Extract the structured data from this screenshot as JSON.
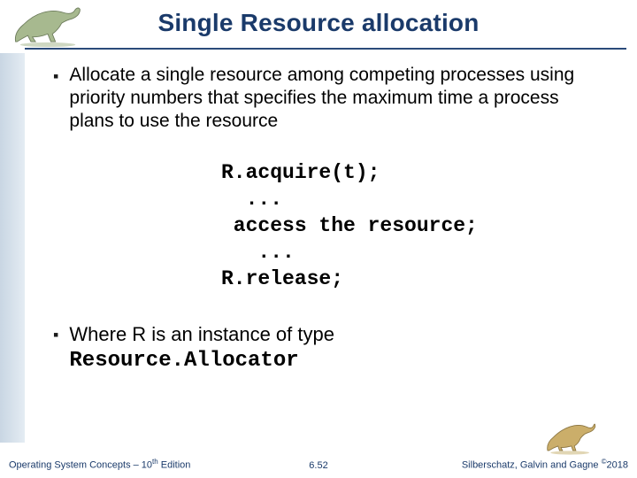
{
  "title": "Single Resource allocation",
  "bullets": {
    "b1": "Allocate a single resource among competing processes using priority numbers that specifies  the maximum time a process  plans to use the resource",
    "b2_prefix": "Where R is an instance of  type ",
    "b2_code": "Resource.Allocator"
  },
  "code": {
    "l1": "R.acquire(t);",
    "l2": "  ...",
    "l3": " access the resource;",
    "l4": "   ...",
    "l5": "R.release;"
  },
  "footer": {
    "left_prefix": "Operating System Concepts – 10",
    "left_sup": "th",
    "left_suffix": " Edition",
    "center": "6.52",
    "right_prefix": "Silberschatz, Galvin and Gagne ",
    "right_sup": "©",
    "right_suffix": "2018"
  }
}
